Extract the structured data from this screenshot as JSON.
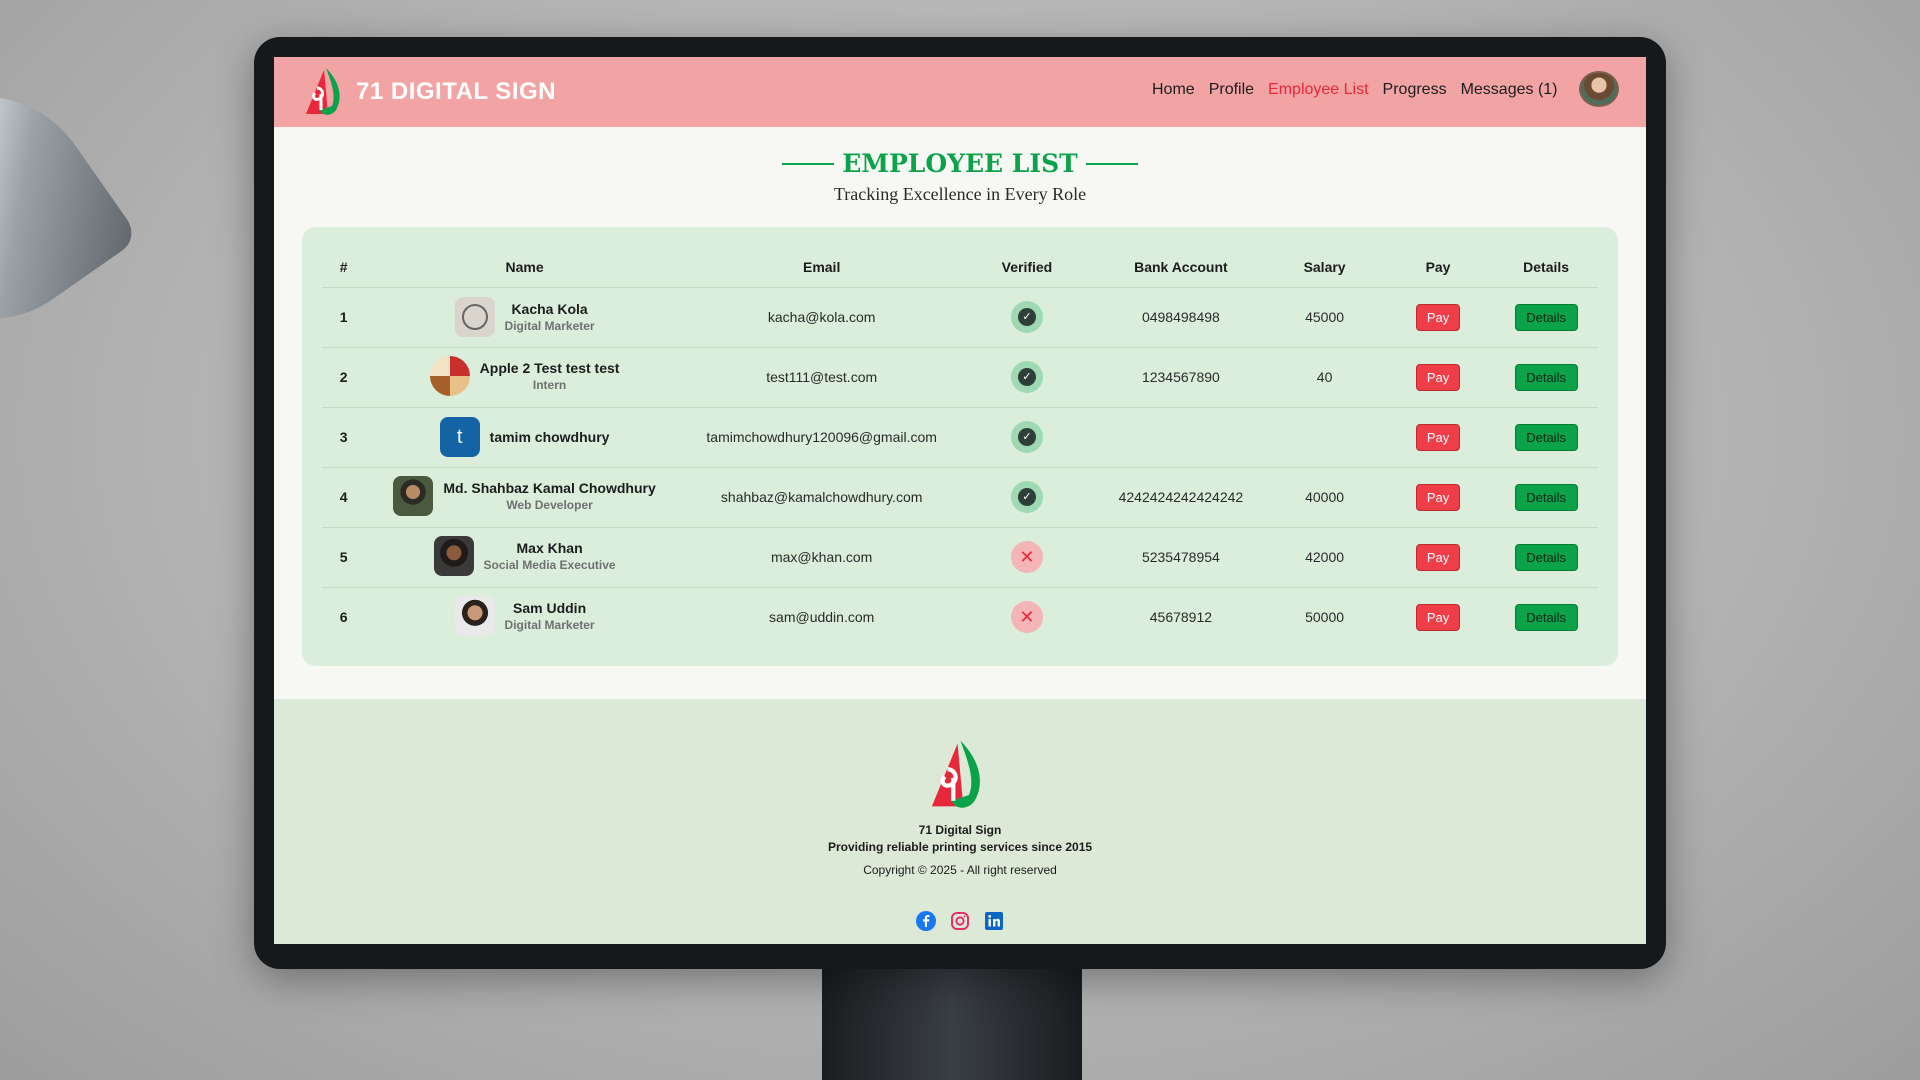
{
  "colors": {
    "navbar": "#f2a3a3",
    "accent_green": "#0aa34a",
    "active_link": "#e8283a",
    "pay_button": "#ef3e48",
    "card_bg": "#dbeedb"
  },
  "navbar": {
    "brand_name": "71 DIGITAL SIGN",
    "links": [
      {
        "label": "Home",
        "active": false
      },
      {
        "label": "Profile",
        "active": false
      },
      {
        "label": "Employee List",
        "active": true
      },
      {
        "label": "Progress",
        "active": false
      },
      {
        "label": "Messages (1)",
        "active": false
      }
    ],
    "avatar_icon": "user-avatar"
  },
  "page": {
    "title": "EMPLOYEE LIST",
    "subtitle": "Tracking Excellence in Every Role"
  },
  "table": {
    "headers": [
      "#",
      "Name",
      "Email",
      "Verified",
      "Bank Account",
      "Salary",
      "Pay",
      "Details"
    ],
    "pay_label": "Pay",
    "details_label": "Details",
    "rows": [
      {
        "index": "1",
        "name": "Kacha Kola",
        "role": "Digital Marketer",
        "email": "kacha@kola.com",
        "verified": true,
        "bank": "0498498498",
        "salary": "45000",
        "thumb": "round-logo"
      },
      {
        "index": "2",
        "name": "Apple 2 Test test test",
        "role": "Intern",
        "email": "test111@test.com",
        "verified": true,
        "bank": "1234567890",
        "salary": "40",
        "thumb": "box"
      },
      {
        "index": "3",
        "name": "tamim chowdhury",
        "role": "",
        "email": "tamimchowdhury120096@gmail.com",
        "verified": true,
        "bank": "",
        "salary": "",
        "thumb": "letter-t"
      },
      {
        "index": "4",
        "name": "Md. Shahbaz Kamal Chowdhury",
        "role": "Web Developer",
        "email": "shahbaz@kamalchowdhury.com",
        "verified": true,
        "bank": "4242424242424242",
        "salary": "40000",
        "thumb": "photo"
      },
      {
        "index": "5",
        "name": "Max Khan",
        "role": "Social Media Executive",
        "email": "max@khan.com",
        "verified": false,
        "bank": "5235478954",
        "salary": "42000",
        "thumb": "photo"
      },
      {
        "index": "6",
        "name": "Sam Uddin",
        "role": "Digital Marketer",
        "email": "sam@uddin.com",
        "verified": false,
        "bank": "45678912",
        "salary": "50000",
        "thumb": "photo"
      }
    ]
  },
  "footer": {
    "company": "71 Digital Sign",
    "tagline": "Providing reliable printing services since 2015",
    "copyright": "Copyright © 2025 - All right reserved",
    "socials": [
      "facebook-icon",
      "instagram-icon",
      "linkedin-icon"
    ]
  }
}
